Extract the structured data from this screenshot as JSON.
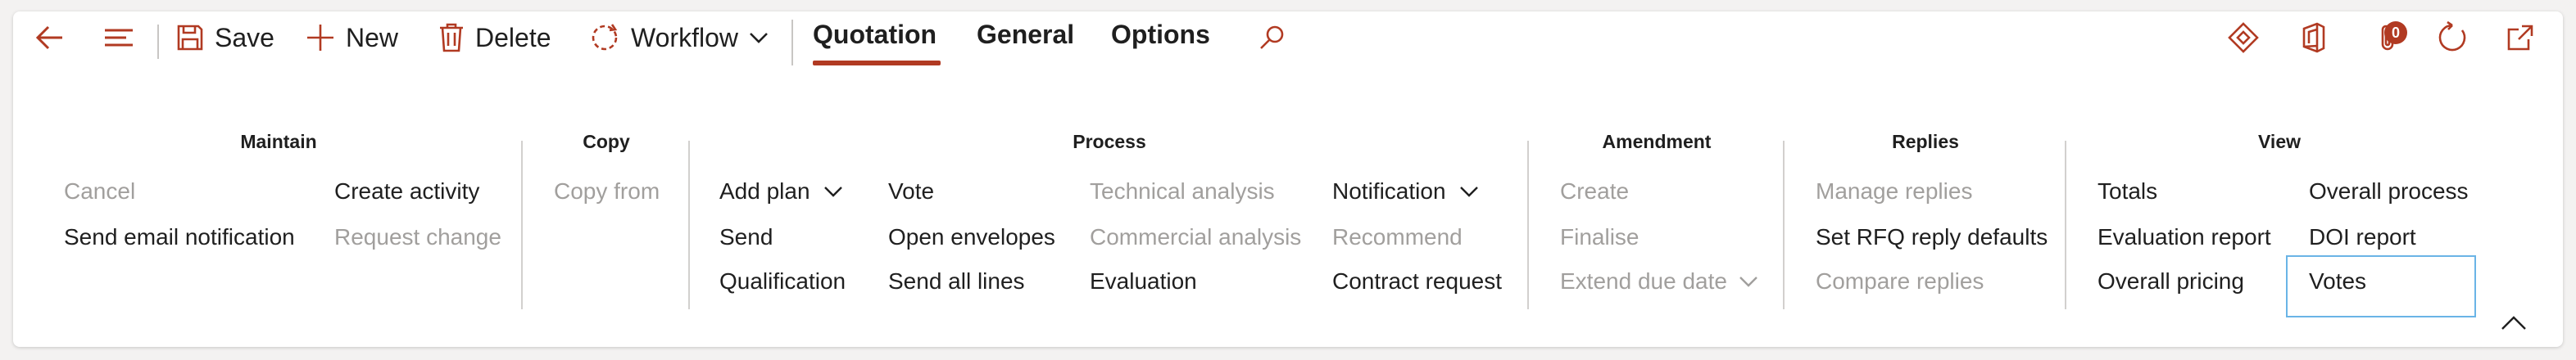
{
  "toolbar": {
    "save_label": "Save",
    "new_label": "New",
    "delete_label": "Delete",
    "workflow_label": "Workflow"
  },
  "tabs": [
    {
      "label": "Quotation",
      "selected": true
    },
    {
      "label": "General",
      "selected": false
    },
    {
      "label": "Options",
      "selected": false
    }
  ],
  "notifications": {
    "count": "0"
  },
  "accent_color": "#b13a22",
  "groups": {
    "maintain": {
      "title": "Maintain",
      "items": {
        "cancel": "Cancel",
        "send_email_notification": "Send email notification",
        "create_activity": "Create activity",
        "request_change": "Request change"
      }
    },
    "copy": {
      "title": "Copy",
      "items": {
        "copy_from": "Copy from"
      }
    },
    "process": {
      "title": "Process",
      "items": {
        "add_plan": "Add plan",
        "send": "Send",
        "qualification": "Qualification",
        "vote": "Vote",
        "open_envelopes": "Open envelopes",
        "send_all_lines": "Send all lines",
        "technical_analysis": "Technical analysis",
        "commercial_analysis": "Commercial analysis",
        "evaluation": "Evaluation",
        "notification": "Notification",
        "recommend": "Recommend",
        "contract_request": "Contract request"
      }
    },
    "amendment": {
      "title": "Amendment",
      "items": {
        "create": "Create",
        "finalise": "Finalise",
        "extend_due_date": "Extend due date"
      }
    },
    "replies": {
      "title": "Replies",
      "items": {
        "manage_replies": "Manage replies",
        "set_rfq_reply_defaults": "Set RFQ reply defaults",
        "compare_replies": "Compare replies"
      }
    },
    "view": {
      "title": "View",
      "items": {
        "totals": "Totals",
        "evaluation_report": "Evaluation report",
        "overall_pricing": "Overall pricing",
        "overall_process": "Overall process",
        "doi_report": "DOI report",
        "votes": "Votes"
      }
    }
  }
}
